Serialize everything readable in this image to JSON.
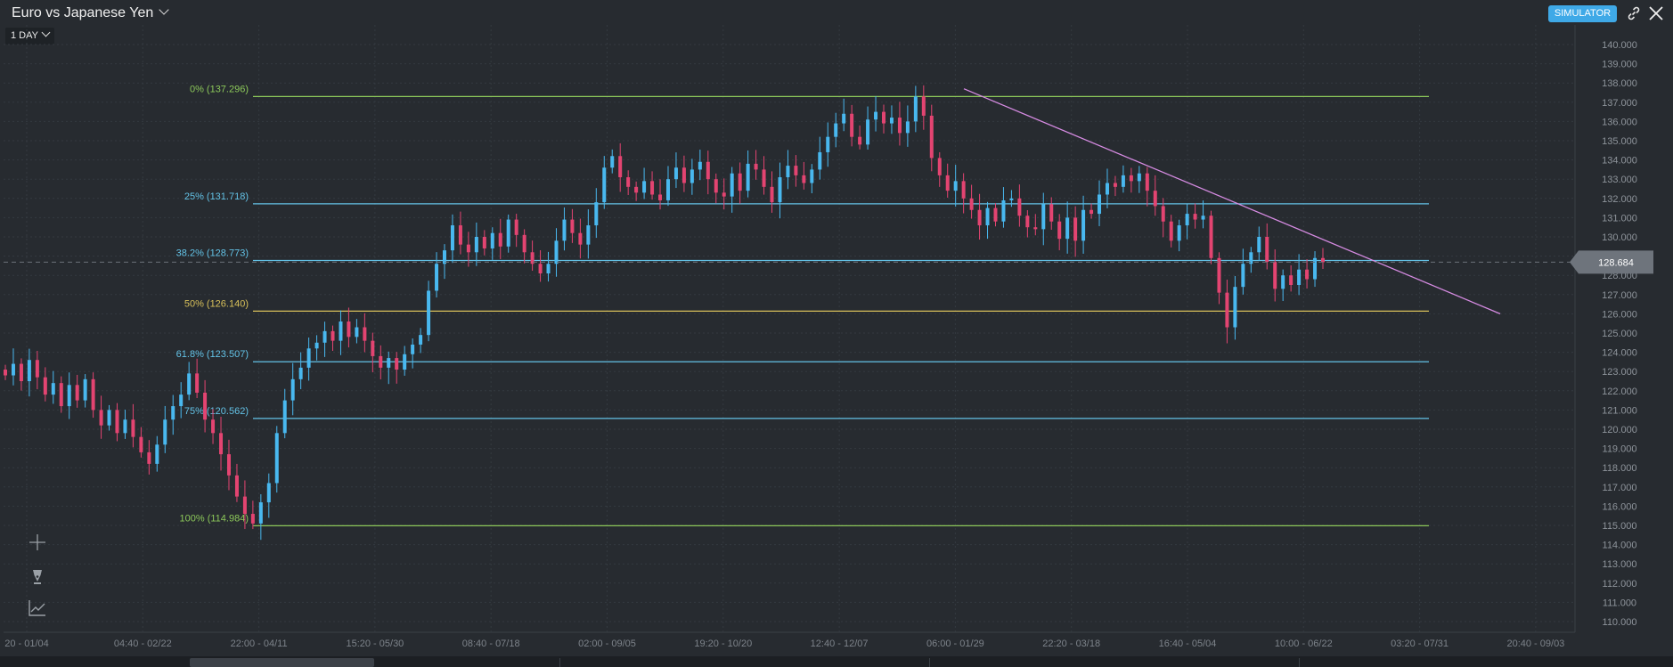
{
  "header": {
    "title": "Euro vs Japanese Yen",
    "timeframe": "1 DAY",
    "simulator_label": "SIMULATOR"
  },
  "icons": {
    "dropdown": "chevron-down-icon",
    "link": "link-icon",
    "close": "close-icon",
    "crosshair": "crosshair-icon",
    "pen": "pen-icon",
    "indicator": "line-chart-icon"
  },
  "colors": {
    "background": "#272b30",
    "up_candle": "#49b8ef",
    "down_candle": "#e34471",
    "trendline": "#d68be2",
    "fib_green": "#8cc85a",
    "fib_blue": "#63c2e6",
    "fib_yellow": "#d8c05a",
    "price_tag": "#6e747c"
  },
  "chart_data": {
    "type": "candlestick",
    "title": "Euro vs Japanese Yen",
    "timeframe": "1 DAY",
    "ylim": [
      110,
      140
    ],
    "y_ticks": [
      "140.000",
      "139.000",
      "138.000",
      "137.000",
      "136.000",
      "135.000",
      "134.000",
      "133.000",
      "132.000",
      "131.000",
      "130.000",
      "129.000",
      "128.000",
      "127.000",
      "126.000",
      "125.000",
      "124.000",
      "123.000",
      "122.000",
      "121.000",
      "120.000",
      "119.000",
      "118.000",
      "117.000",
      "116.000",
      "115.000",
      "114.000",
      "113.000",
      "112.000",
      "111.000",
      "110.000"
    ],
    "x_ticks": [
      "20 - 01/04",
      "04:40 - 02/22",
      "22:00 - 04/11",
      "15:20 - 05/30",
      "08:40 - 07/18",
      "02:00 - 09/05",
      "19:20 - 10/20",
      "12:40 - 12/07",
      "06:00 - 01/29",
      "22:20 - 03/18",
      "16:40 - 05/04",
      "10:00 - 06/22",
      "03:20 - 07/31",
      "20:40 - 09/03"
    ],
    "current_price": "128.684",
    "fibonacci": [
      {
        "label": "0% (137.296)",
        "value": 137.296,
        "color": "#8cc85a"
      },
      {
        "label": "25% (131.718)",
        "value": 131.718,
        "color": "#63c2e6"
      },
      {
        "label": "38.2% (128.773)",
        "value": 128.773,
        "color": "#63c2e6"
      },
      {
        "label": "50% (126.140)",
        "value": 126.14,
        "color": "#d8c05a"
      },
      {
        "label": "61.8% (123.507)",
        "value": 123.507,
        "color": "#63c2e6"
      },
      {
        "label": "75% (120.562)",
        "value": 120.562,
        "color": "#63c2e6"
      },
      {
        "label": "100% (114.984)",
        "value": 114.984,
        "color": "#8cc85a"
      }
    ],
    "price_path": [
      122.8,
      123.4,
      122.5,
      123.6,
      122.7,
      121.8,
      122.4,
      121.2,
      122.3,
      121.5,
      122.6,
      121.0,
      120.2,
      121.0,
      119.8,
      120.5,
      119.6,
      118.8,
      118.2,
      119.2,
      120.5,
      121.2,
      121.8,
      122.9,
      121.9,
      120.5,
      119.8,
      118.7,
      117.6,
      116.5,
      115.6,
      115.1,
      116.2,
      117.2,
      119.8,
      121.5,
      122.6,
      123.2,
      124.2,
      124.5,
      125.1,
      124.6,
      125.6,
      124.8,
      125.3,
      124.6,
      123.8,
      123.2,
      123.7,
      123.1,
      123.9,
      124.4,
      124.9,
      127.2,
      128.6,
      129.3,
      130.6,
      129.6,
      129.2,
      130.0,
      129.4,
      130.2,
      129.5,
      130.9,
      130.1,
      129.2,
      128.6,
      128.1,
      128.6,
      129.8,
      130.9,
      130.2,
      129.6,
      130.6,
      131.8,
      133.6,
      134.2,
      133.1,
      132.6,
      132.3,
      132.9,
      132.2,
      131.9,
      133.0,
      133.6,
      132.8,
      133.5,
      133.9,
      133.0,
      132.3,
      132.1,
      133.3,
      132.4,
      133.8,
      133.5,
      132.6,
      131.8,
      133.1,
      133.7,
      133.2,
      132.8,
      133.5,
      134.4,
      135.2,
      135.9,
      136.4,
      135.2,
      134.8,
      136.1,
      136.5,
      135.9,
      136.2,
      135.4,
      136.0,
      137.3,
      136.3,
      134.1,
      133.2,
      132.4,
      132.9,
      132.0,
      131.4,
      130.6,
      131.5,
      130.8,
      131.9,
      132.0,
      131.1,
      130.5,
      130.4,
      131.7,
      130.8,
      129.9,
      131.0,
      129.8,
      131.4,
      131.2,
      132.2,
      132.8,
      132.6,
      133.2,
      132.9,
      133.3,
      132.4,
      131.6,
      130.8,
      129.8,
      130.6,
      131.2,
      130.9,
      131.1,
      128.9,
      127.1,
      125.3,
      127.4,
      128.6,
      129.2,
      130.0,
      128.7,
      127.3,
      128.0,
      127.5,
      128.3,
      127.8,
      128.9,
      128.684
    ]
  }
}
